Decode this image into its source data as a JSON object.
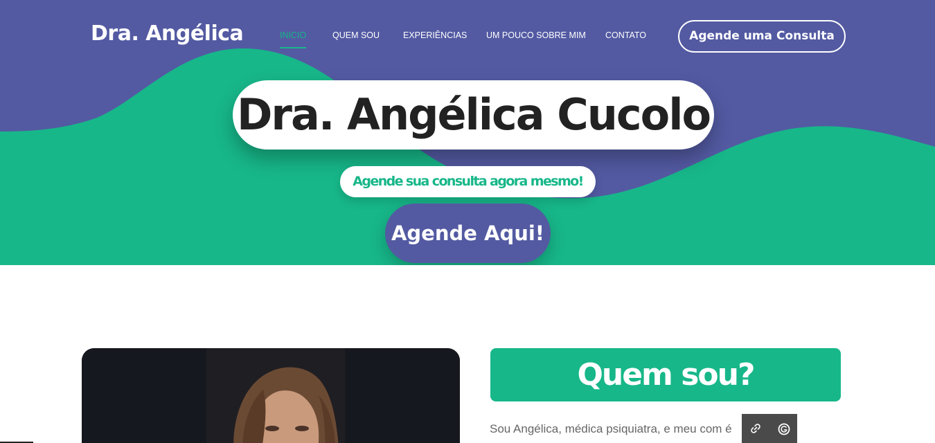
{
  "header": {
    "logo": "Dra. Angélica",
    "nav": [
      {
        "label": "INICIO",
        "active": true
      },
      {
        "label": "QUEM SOU",
        "active": false
      },
      {
        "label": "EXPERIÊNCIAS",
        "active": false
      },
      {
        "label": "UM POUCO SOBRE MIM",
        "active": false
      },
      {
        "label": "CONTATO",
        "active": false
      }
    ],
    "cta_label": "Agende uma Consulta"
  },
  "hero": {
    "title": "Dra. Angélica Cucolo",
    "subtitle": "Agende sua consulta agora mesmo!",
    "button_label": "Agende Aqui!"
  },
  "about": {
    "heading": "Quem sou?",
    "text": "Sou Angélica, médica psiquiatra, e meu com          é"
  },
  "floating_toolbar": {
    "icons": [
      "link-icon",
      "grammarly-icon"
    ]
  },
  "colors": {
    "primary_purple": "#535aa2",
    "accent_green": "#17b789",
    "white": "#ffffff",
    "title_text": "#222222"
  }
}
